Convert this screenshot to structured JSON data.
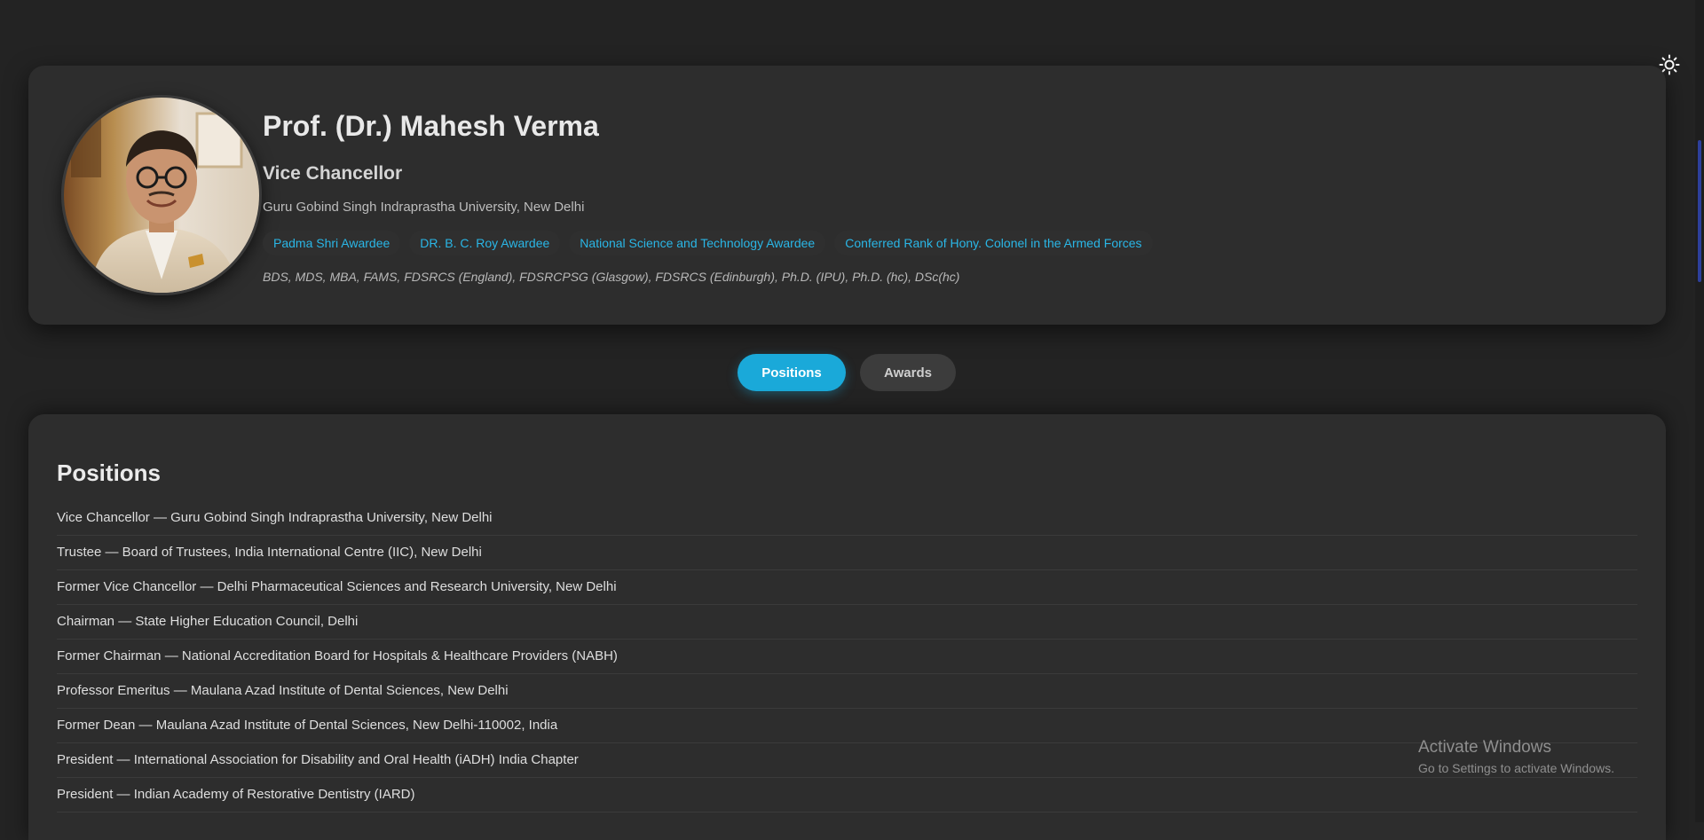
{
  "profile": {
    "name": "Prof. (Dr.) Mahesh Verma",
    "role": "Vice Chancellor",
    "university": "Guru Gobind Singh Indraprastha University, New Delhi",
    "badges": [
      "Padma Shri Awardee",
      "DR. B. C. Roy Awardee",
      "National Science and Technology Awardee",
      "Conferred Rank of Hony. Colonel in the Armed Forces"
    ],
    "degrees": "BDS, MDS, MBA, FAMS, FDSRCS (England), FDSRCPSG (Glasgow), FDSRCS (Edinburgh), Ph.D. (IPU), Ph.D. (hc), DSc(hc)"
  },
  "tabs": [
    {
      "label": "Positions",
      "active": true
    },
    {
      "label": "Awards",
      "active": false
    }
  ],
  "positions": {
    "title": "Positions",
    "items": [
      "Vice Chancellor — Guru Gobind Singh Indraprastha University, New Delhi",
      "Trustee — Board of Trustees, India International Centre (IIC), New Delhi",
      "Former Vice Chancellor — Delhi Pharmaceutical Sciences and Research University, New Delhi",
      "Chairman — State Higher Education Council, Delhi",
      "Former Chairman — National Accreditation Board for Hospitals & Healthcare Providers (NABH)",
      "Professor Emeritus — Maulana Azad Institute of Dental Sciences, New Delhi",
      "Former Dean — Maulana Azad Institute of Dental Sciences, New Delhi-110002, India",
      "President — International Association for Disability and Oral Health (iADH) India Chapter",
      "President — Indian Academy of Restorative Dentistry (IARD)"
    ]
  },
  "watermark": {
    "title": "Activate Windows",
    "subtitle": "Go to Settings to activate Windows."
  },
  "icons": {
    "theme_toggle": "sun-icon"
  },
  "colors": {
    "background": "#232323",
    "card": "#2d2d2d",
    "accent": "#1aa9d9",
    "badge_text": "#2ab6e6"
  }
}
